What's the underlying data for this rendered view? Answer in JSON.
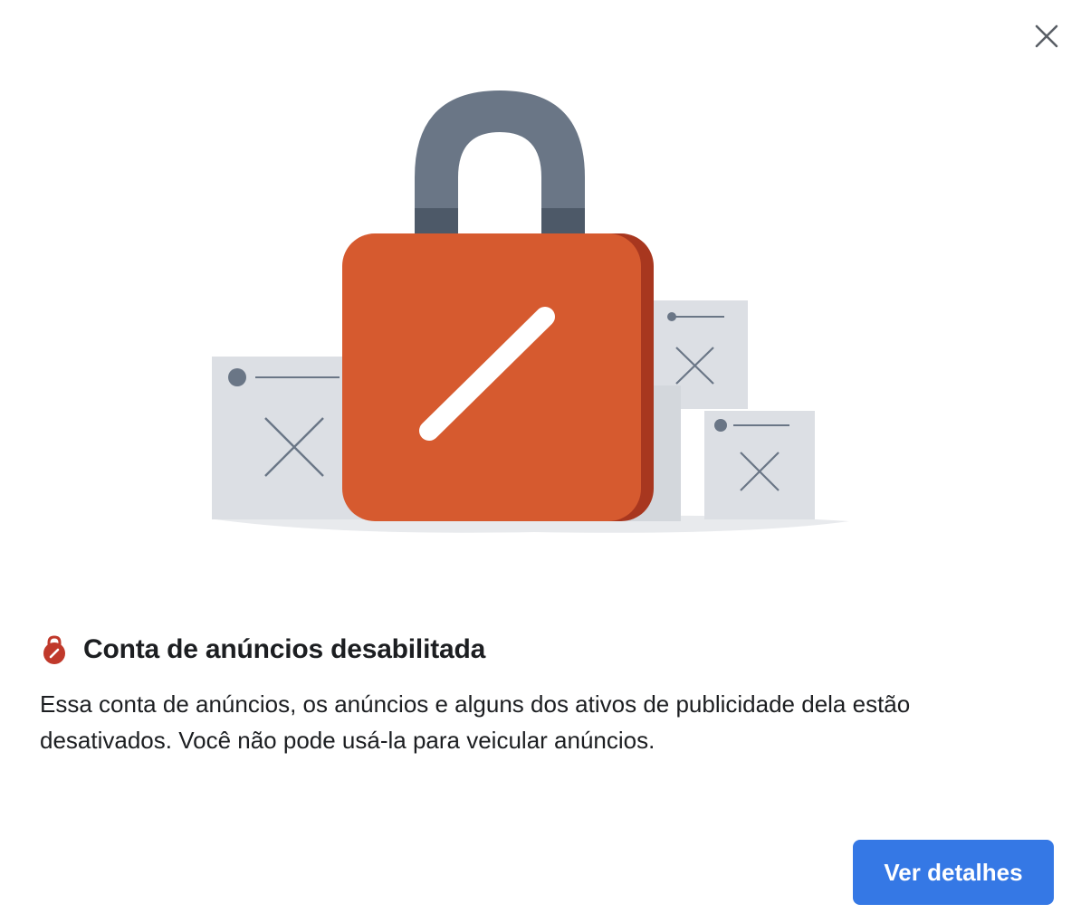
{
  "dialog": {
    "close_icon": "close-icon",
    "illustration_icon": "padlock-disabled-illustration",
    "title_icon": "lock-disabled-icon",
    "title": "Conta de anúncios desabilitada",
    "body_line1": "Essa conta de anúncios, os anúncios e alguns dos ativos de publicidade dela estão",
    "body_line2": "desativados. Você não pode usá-la para veicular anúncios.",
    "primary_button_label": "Ver detalhes"
  },
  "colors": {
    "accent": "#3578e5",
    "lock_orange": "#d65a2f",
    "lock_shackle": "#6a7686",
    "card_gray": "#dcdfe4",
    "text": "#1c1e21"
  }
}
